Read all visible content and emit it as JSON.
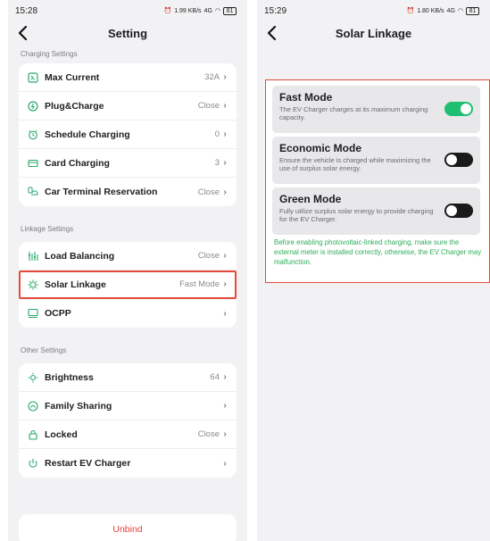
{
  "left_screen": {
    "status": {
      "time": "15:28",
      "speed": "1.99 KB/s",
      "network": "4G",
      "battery": "81"
    },
    "nav": {
      "title": "Setting"
    },
    "charging_settings": {
      "heading": "Charging Settings",
      "items": [
        {
          "label": "Max Current",
          "value": "32A",
          "icon": "current-icon"
        },
        {
          "label": "Plug&Charge",
          "value": "Close",
          "icon": "plug-icon"
        },
        {
          "label": "Schedule Charging",
          "value": "0",
          "icon": "alarm-clock-icon"
        },
        {
          "label": "Card Charging",
          "value": "3",
          "icon": "card-icon"
        },
        {
          "label": "Car Terminal Reservation",
          "value": "Close",
          "icon": "car-terminal-icon"
        }
      ]
    },
    "linkage_settings": {
      "heading": "Linkage Settings",
      "items": [
        {
          "label": "Load Balancing",
          "value": "Close",
          "icon": "balance-icon"
        },
        {
          "label": "Solar Linkage",
          "value": "Fast Mode",
          "icon": "sun-icon"
        },
        {
          "label": "OCPP",
          "value": "",
          "icon": "monitor-icon"
        }
      ]
    },
    "other_settings": {
      "heading": "Other Settings",
      "items": [
        {
          "label": "Brightness",
          "value": "64",
          "icon": "brightness-icon"
        },
        {
          "label": "Family Sharing",
          "value": "",
          "icon": "share-icon"
        },
        {
          "label": "Locked",
          "value": "Close",
          "icon": "lock-icon"
        },
        {
          "label": "Restart EV Charger",
          "value": "",
          "icon": "power-icon"
        }
      ]
    },
    "unbind_label": "Unbind"
  },
  "right_screen": {
    "status": {
      "time": "15:29",
      "speed": "1.80 KB/s",
      "network": "4G",
      "battery": "81"
    },
    "nav": {
      "title": "Solar Linkage"
    },
    "modes": [
      {
        "title": "Fast Mode",
        "description": "The EV Charger charges at its maximum charging capacity.",
        "enabled": true
      },
      {
        "title": "Economic Mode",
        "description": "Ensure the vehicle is charged while maximizing the use of surplus solar energy.",
        "enabled": false
      },
      {
        "title": "Green Mode",
        "description": "Fully utilize surplus solar energy to provide charging for the EV Charger.",
        "enabled": false
      }
    ],
    "note": "Before enabling photovoltaic-linked charging, make sure the external meter is installed correctly, otherwise, the EV Charger may malfunction."
  },
  "colors": {
    "accent_green": "#1fbf72",
    "highlight_red": "#e34b3a",
    "unbind_red": "#e0443a",
    "note_green": "#2fae5a"
  }
}
